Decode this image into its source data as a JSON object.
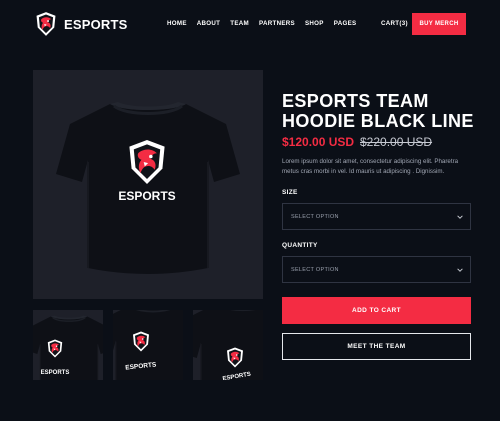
{
  "header": {
    "brand": "ESPORTS",
    "nav": [
      "HOME",
      "ABOUT",
      "TEAM",
      "PARTNERS",
      "SHOP",
      "PAGES"
    ],
    "cart_label": "CART(3)",
    "buy_label": "BUY MERCH"
  },
  "product": {
    "title": "ESPORTS TEAM HOODIE BLACK LINE",
    "price": "$120.00 USD",
    "old_price": "$220.00 USD",
    "description": "Lorem ipsum dolor sit amet, consectetur adipiscing elit. Pharetra metus cras morbi in vel. Id mauris ut adipiscing . Dignissim.",
    "image_text": "ESPORTS",
    "size": {
      "label": "SIZE",
      "value": "SELECT OPTION"
    },
    "quantity": {
      "label": "QUANTITY",
      "value": "SELECT OPTION"
    },
    "add_to_cart": "ADD TO CART",
    "meet_team": "MEET THE TEAM"
  },
  "colors": {
    "accent": "#f42c43",
    "background": "#0b0f17",
    "panel": "#1e2029"
  },
  "icons": {
    "logo": "dragon-shield-icon",
    "select_caret": "chevron-down-icon"
  }
}
